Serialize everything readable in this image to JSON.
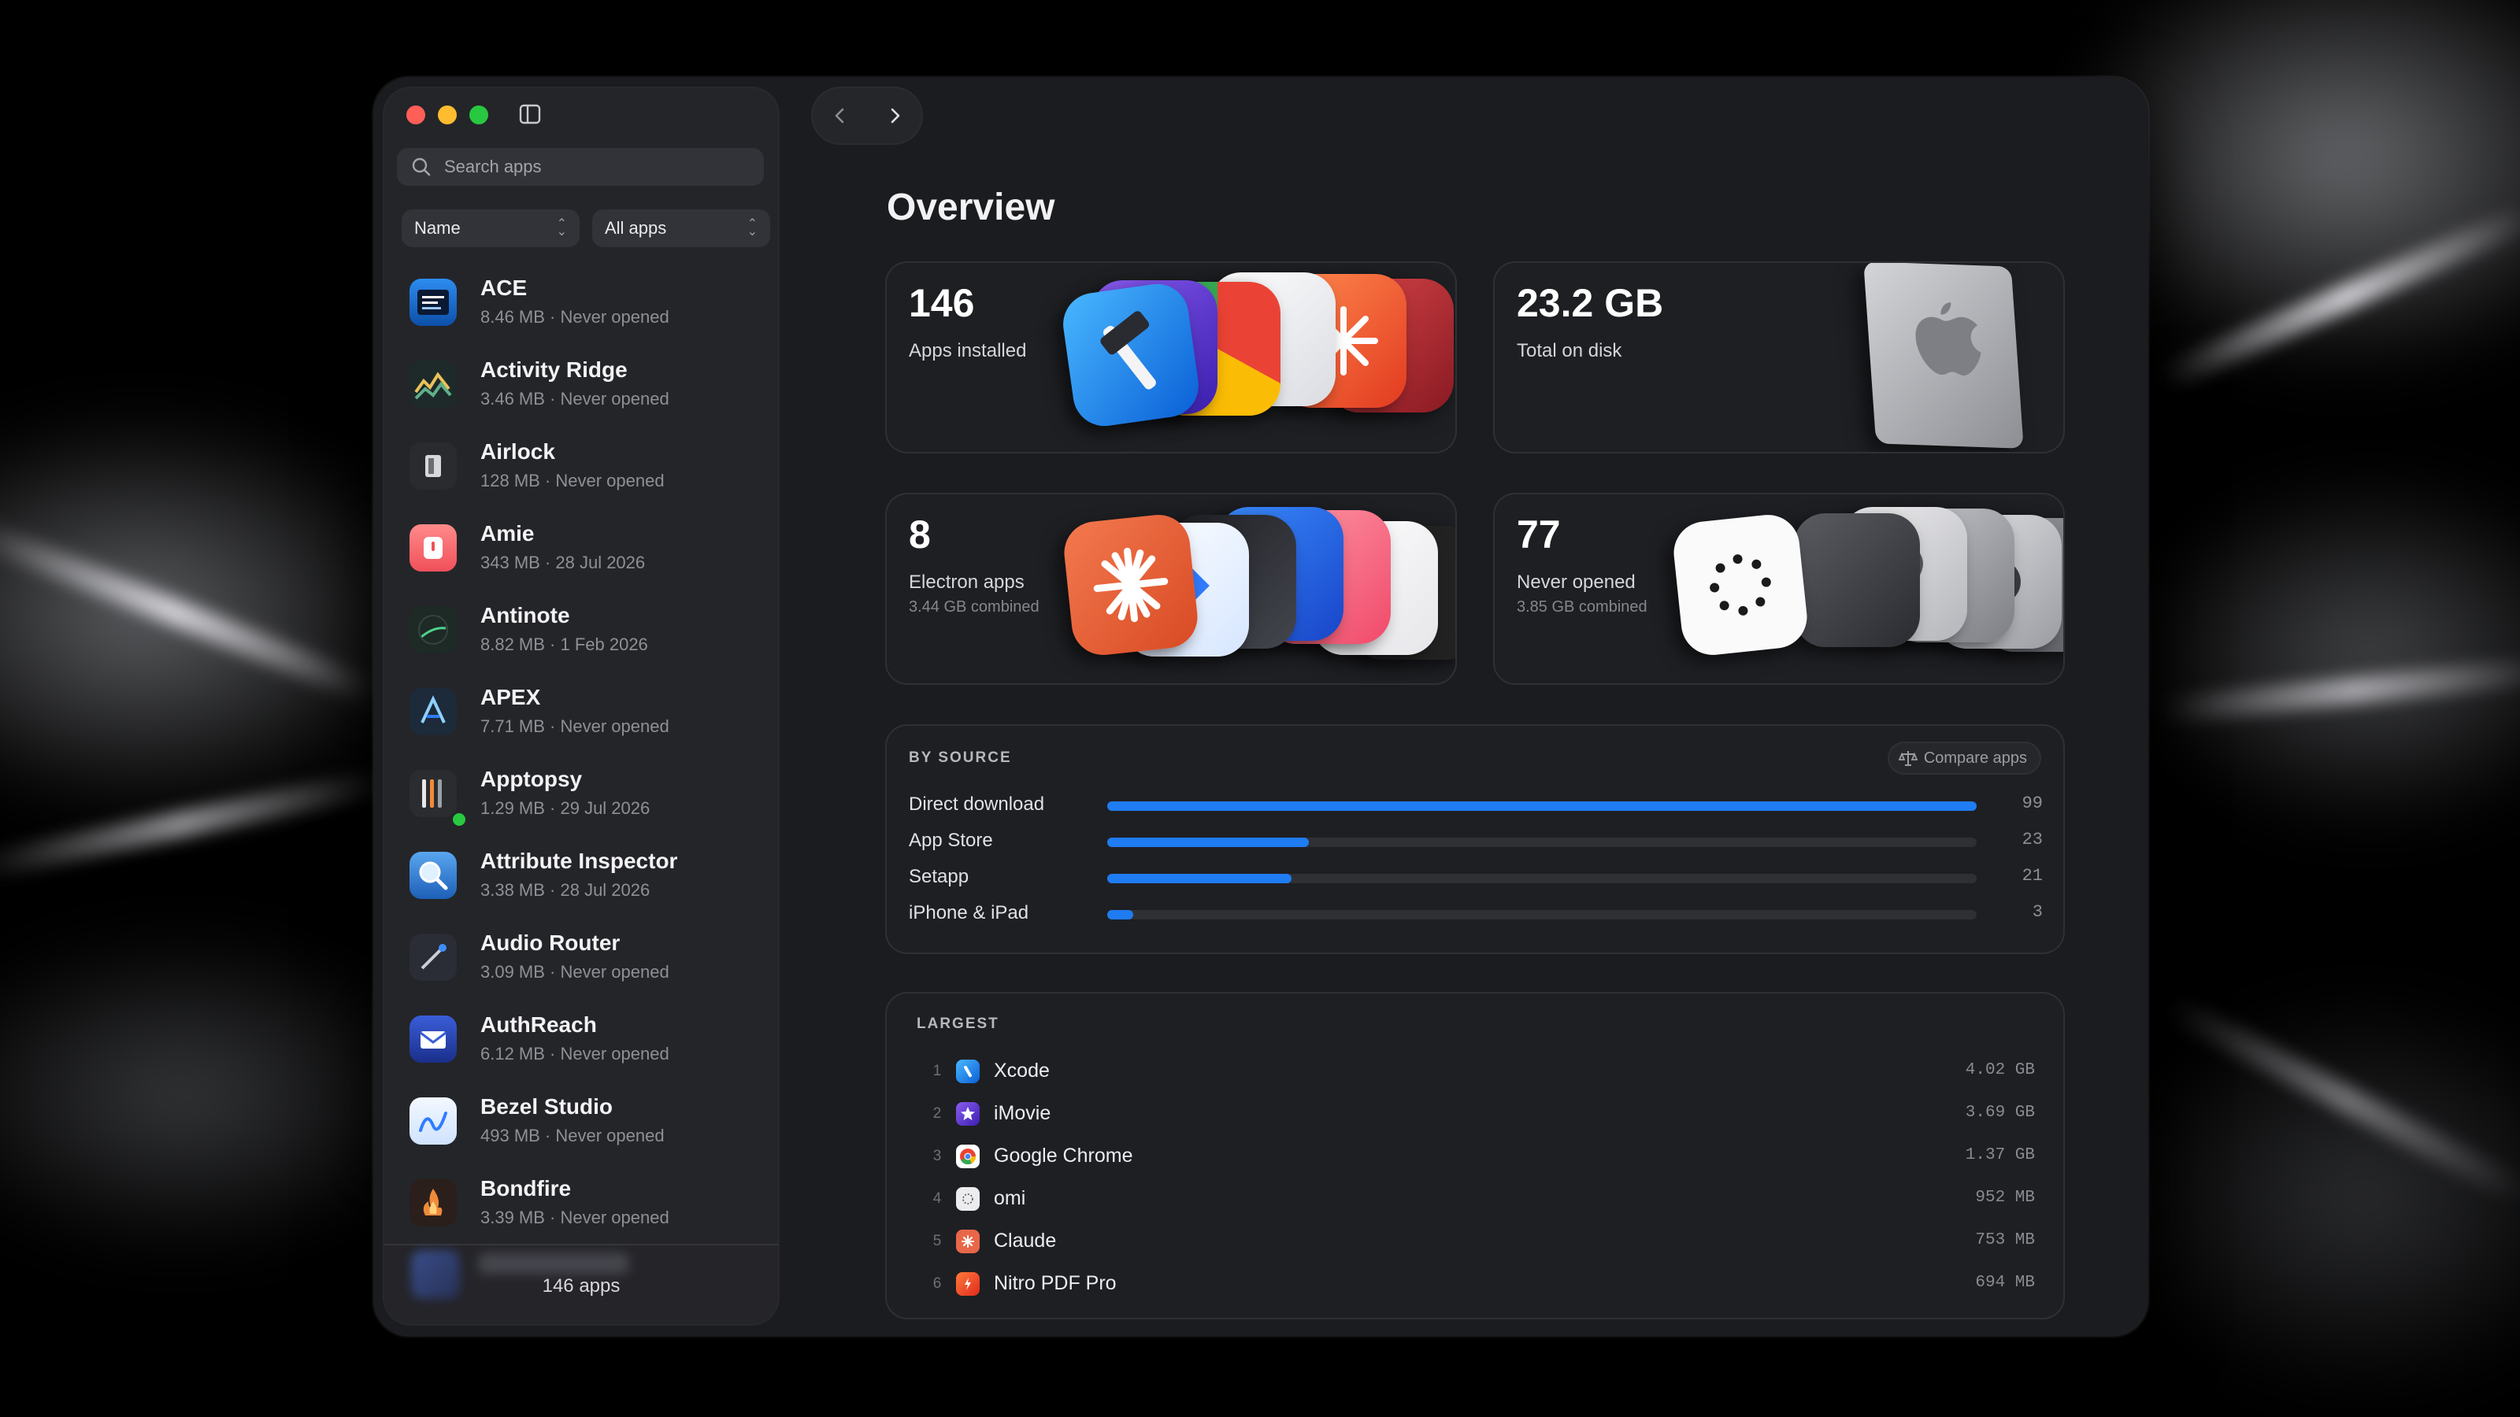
{
  "window": {
    "search_placeholder": "Search apps",
    "sort_select": "Name",
    "filter_select": "All apps",
    "footer_count": "146 apps"
  },
  "apps": [
    {
      "name": "ACE",
      "meta": "8.46 MB · Never opened",
      "icon": "ace-icon"
    },
    {
      "name": "Activity Ridge",
      "meta": "3.46 MB · Never opened",
      "icon": "activity-ridge-icon"
    },
    {
      "name": "Airlock",
      "meta": "128 MB · Never opened",
      "icon": "airlock-icon"
    },
    {
      "name": "Amie",
      "meta": "343 MB · 28 Jul 2026",
      "icon": "amie-icon"
    },
    {
      "name": "Antinote",
      "meta": "8.82 MB · 1 Feb 2026",
      "icon": "antinote-icon"
    },
    {
      "name": "APEX",
      "meta": "7.71 MB · Never opened",
      "icon": "apex-icon"
    },
    {
      "name": "Apptopsy",
      "meta": "1.29 MB · 29 Jul 2026",
      "icon": "apptopsy-icon"
    },
    {
      "name": "Attribute Inspector",
      "meta": "3.38 MB · 28 Jul 2026",
      "icon": "attribute-inspector-icon"
    },
    {
      "name": "Audio Router",
      "meta": "3.09 MB · Never opened",
      "icon": "audio-router-icon"
    },
    {
      "name": "AuthReach",
      "meta": "6.12 MB · Never opened",
      "icon": "authreach-icon"
    },
    {
      "name": "Bezel Studio",
      "meta": "493 MB · Never opened",
      "icon": "bezel-studio-icon"
    },
    {
      "name": "Bondfire",
      "meta": "3.39 MB · Never opened",
      "icon": "bondfire-icon"
    }
  ],
  "overview": {
    "title": "Overview",
    "cards": [
      {
        "value": "146",
        "label": "Apps installed",
        "sub": ""
      },
      {
        "value": "23.2 GB",
        "label": "Total on disk",
        "sub": ""
      },
      {
        "value": "8",
        "label": "Electron apps",
        "sub": "3.44 GB combined"
      },
      {
        "value": "77",
        "label": "Never opened",
        "sub": "3.85 GB combined"
      }
    ]
  },
  "by_source": {
    "heading": "BY SOURCE",
    "compare_label": "Compare apps",
    "max": 99,
    "rows": [
      {
        "label": "Direct download",
        "value": 99
      },
      {
        "label": "App Store",
        "value": 23
      },
      {
        "label": "Setapp",
        "value": 21
      },
      {
        "label": "iPhone & iPad",
        "value": 3
      }
    ]
  },
  "largest": {
    "heading": "LARGEST",
    "rows": [
      {
        "rank": "1",
        "name": "Xcode",
        "size": "4.02 GB",
        "color": "#1e88f0"
      },
      {
        "rank": "2",
        "name": "iMovie",
        "size": "3.69 GB",
        "color": "#6a3fd6"
      },
      {
        "rank": "3",
        "name": "Google Chrome",
        "size": "1.37 GB",
        "color": "#ffffff"
      },
      {
        "rank": "4",
        "name": "omi",
        "size": "952 MB",
        "color": "#e8e8ea"
      },
      {
        "rank": "5",
        "name": "Claude",
        "size": "753 MB",
        "color": "#e8674a"
      },
      {
        "rank": "6",
        "name": "Nitro PDF Pro",
        "size": "694 MB",
        "color": "#f24a2c"
      }
    ]
  },
  "colors": {
    "accent": "#1f7cf2",
    "close": "#ff5f57",
    "minimize": "#febc2e",
    "zoom": "#28c840"
  }
}
